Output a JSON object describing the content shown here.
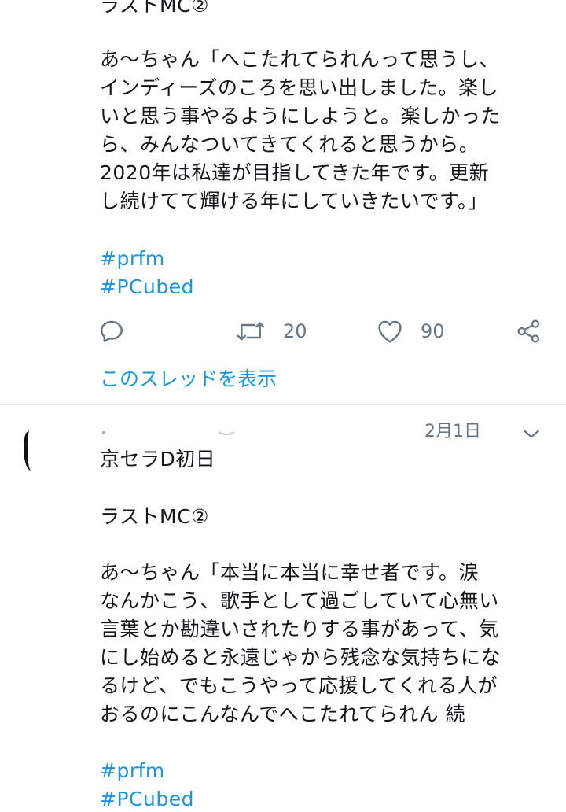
{
  "tweet1": {
    "lines": [
      "ラストMC②",
      "あ〜ちゃん「へこたれてられんって思うし、",
      "インディーズのころを思い出しました。楽し",
      "いと思う事やるようにしようと。楽しかった",
      "ら、みんなついてきてくれると思うから。",
      "2020年は私達が目指してきた年です。更新",
      "し続けてて輝ける年にしていきたいです。」"
    ],
    "hashtags": [
      "#prfm",
      " #PCubed"
    ],
    "actions": {
      "retweet_count": "20",
      "like_count": "90"
    },
    "thread_link": "このスレッドを表示"
  },
  "tweet2": {
    "date": "2月1日",
    "lines": [
      "京セラD初日",
      "ラストMC②",
      "あ〜ちゃん「本当に本当に幸せ者です。涙",
      "なんかこう、歌手として過ごしていて心無い",
      "言葉とか勘違いされたりする事があって、気",
      "にし始めると永遠じゃから残念な気持ちにな",
      "るけど、でもこうやって応援してくれる人が",
      "おるのにこんなんでへこたれてられん 続"
    ],
    "hashtags": [
      "#prfm",
      " #PCubed"
    ]
  },
  "colors": {
    "link": "#1b95e0",
    "muted": "#657786",
    "text": "#14171a",
    "divider": "#e1e8ed"
  },
  "icons": {
    "reply": "reply-icon",
    "retweet": "retweet-icon",
    "like": "heart-icon",
    "share": "share-icon",
    "menu": "chevron-down-icon"
  }
}
